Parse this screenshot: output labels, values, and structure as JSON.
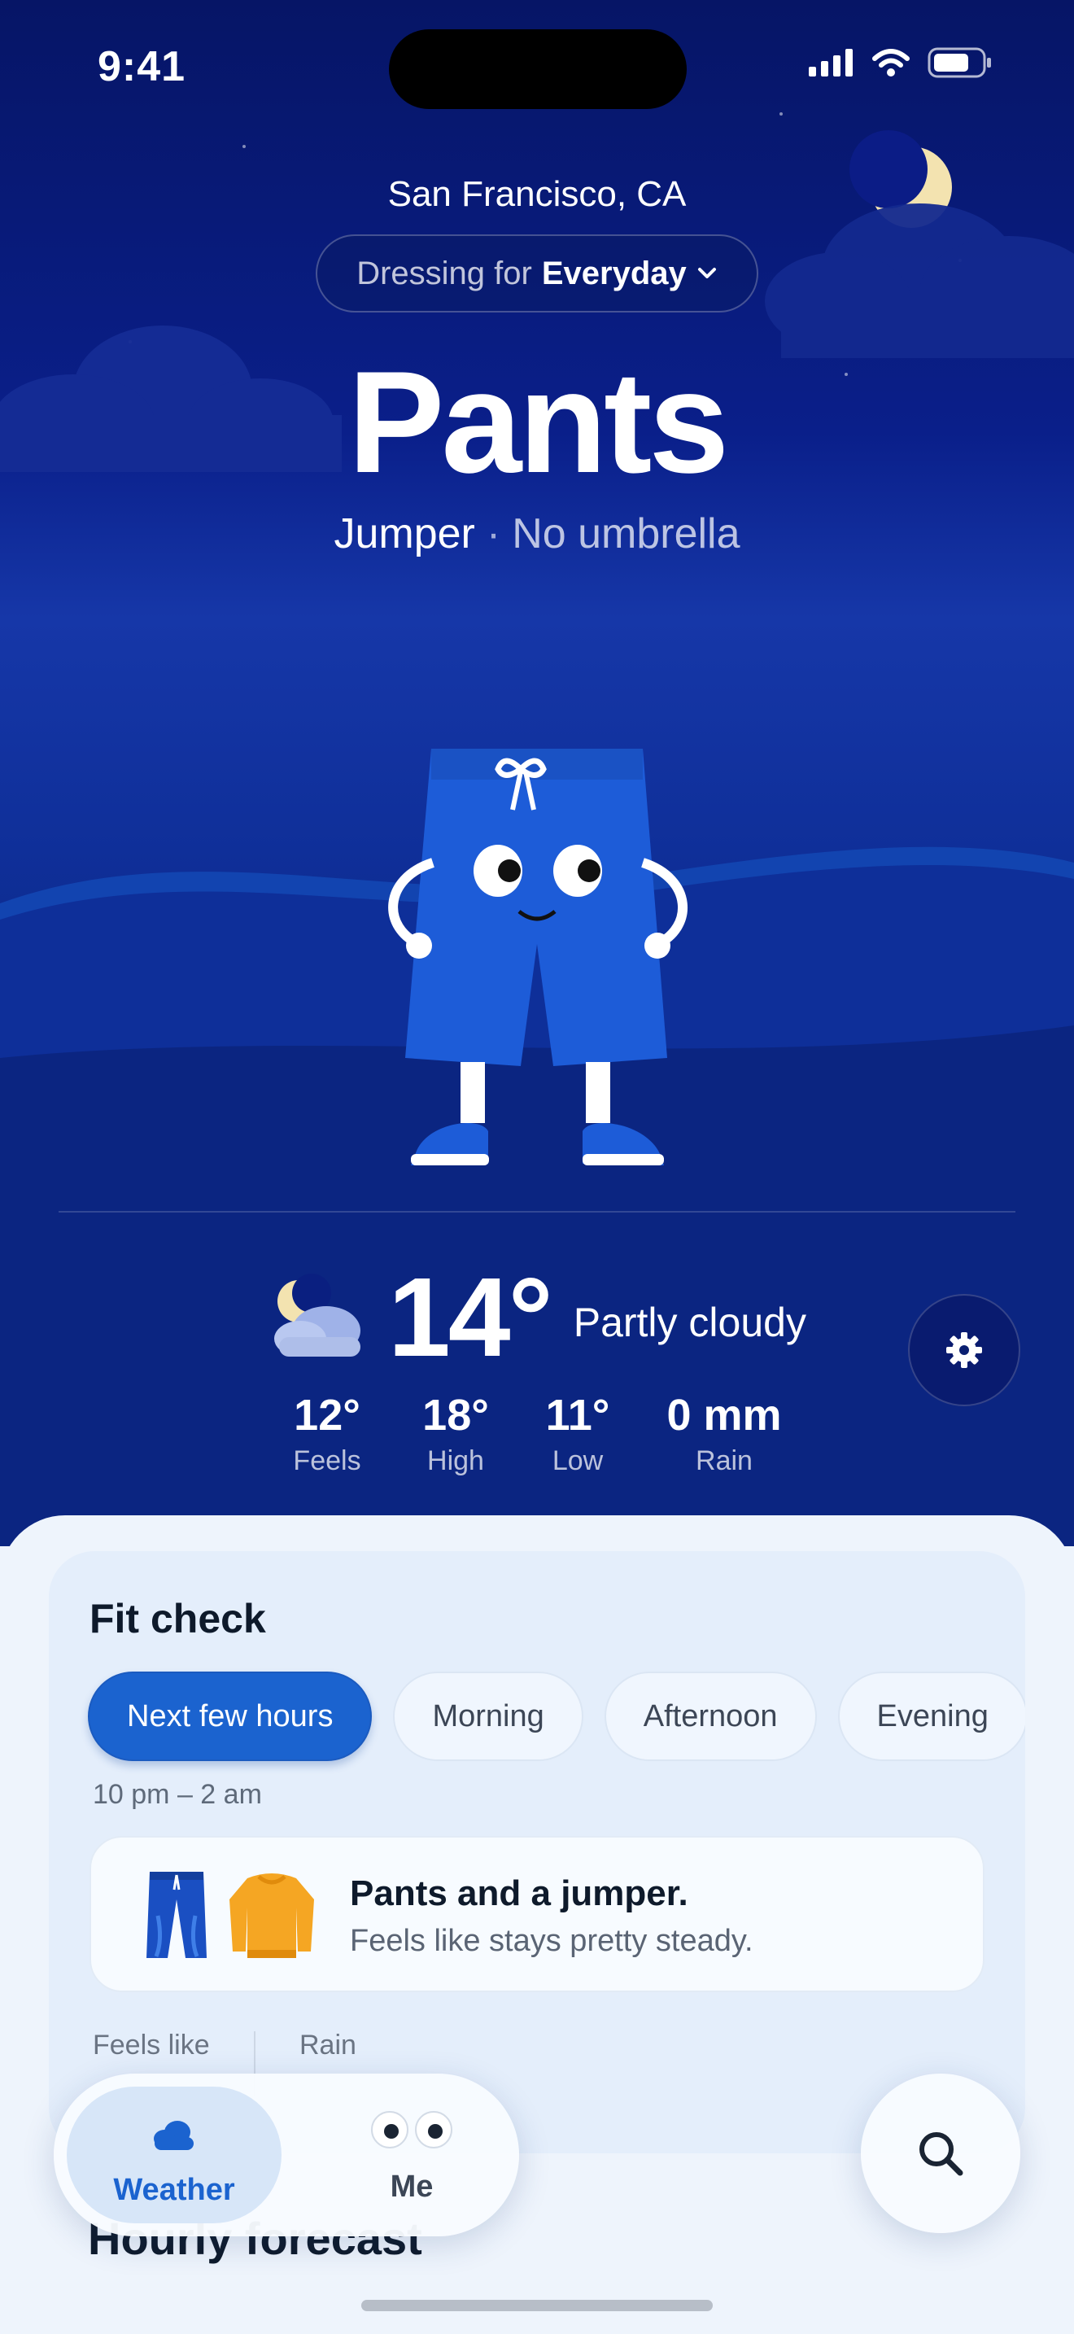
{
  "status_bar": {
    "time": "9:41",
    "icons": [
      "signal-icon",
      "wifi-icon",
      "battery-icon"
    ]
  },
  "header": {
    "location": "San Francisco, CA",
    "mode_prefix": "Dressing for",
    "mode_value": "Everyday",
    "headline": "Pants",
    "secondary_item": "Jumper",
    "separator": "·",
    "umbrella": "No umbrella"
  },
  "current": {
    "temperature": "14°",
    "condition": "Partly cloudy",
    "condition_icon": "moon-cloud-icon",
    "stats": [
      {
        "value": "12°",
        "label": "Feels"
      },
      {
        "value": "18°",
        "label": "High"
      },
      {
        "value": "11°",
        "label": "Low"
      },
      {
        "value": "0 mm",
        "label": "Rain"
      }
    ]
  },
  "fit_check": {
    "title": "Fit check",
    "chips": [
      "Next few hours",
      "Morning",
      "Afternoon",
      "Evening"
    ],
    "active_chip": "Next few hours",
    "time_range": "10 pm – 2 am",
    "advice_title": "Pants and a jumper.",
    "advice_subtitle": "Feels like stays pretty steady.",
    "mini_labels": [
      "Feels like",
      "Rain"
    ]
  },
  "hourly_title": "Hourly forecast",
  "tabbar": {
    "weather_label": "Weather",
    "me_label": "Me"
  },
  "colors": {
    "accent": "#1b63cf",
    "sky_top": "#061566",
    "sky_mid": "#1637a8",
    "sheet": "#eef4fc"
  }
}
